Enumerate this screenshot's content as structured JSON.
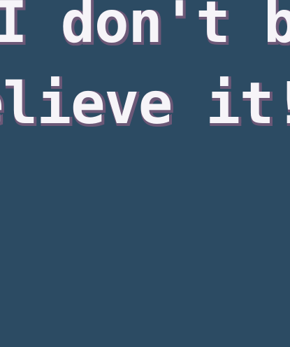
{
  "dialog": {
    "lines": [
      "I don't be",
      "elieve it!"
    ]
  },
  "colors": {
    "background": "#2c4b63",
    "text": "#f6f4f8",
    "shadow": "#6c5877"
  }
}
